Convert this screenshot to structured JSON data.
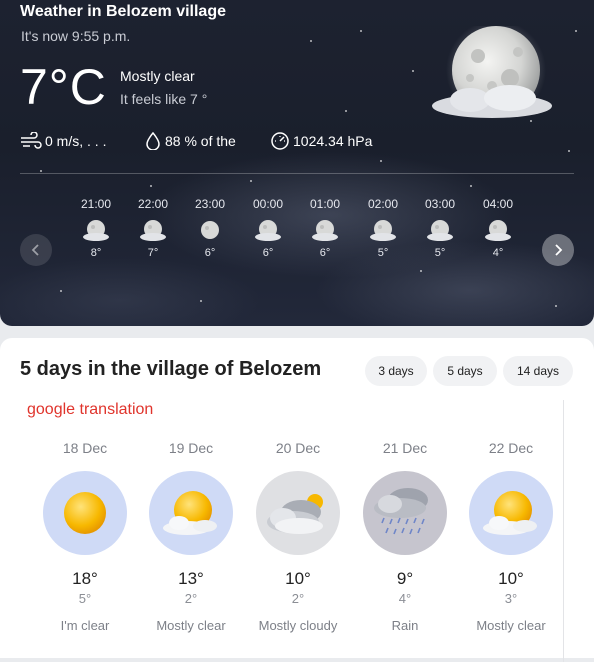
{
  "now": {
    "title": "Weather in Belozem village",
    "subtitle": "It's now 9:55 p.m.",
    "temperature": "7°C",
    "condition": "Mostly clear",
    "feels_like": "It feels like 7 °",
    "icon": "moon-cloud-icon",
    "stats": {
      "wind": "0 m/s,  . . .",
      "humidity": "88 % of the",
      "pressure": "1024.34 hPa"
    }
  },
  "hourly": [
    {
      "time": "21:00",
      "temp": "8°",
      "icon": "moon-icon"
    },
    {
      "time": "22:00",
      "temp": "7°",
      "icon": "moon-icon"
    },
    {
      "time": "23:00",
      "temp": "6°",
      "icon": "moon-icon"
    },
    {
      "time": "00:00",
      "temp": "6°",
      "icon": "moon-icon"
    },
    {
      "time": "01:00",
      "temp": "6°",
      "icon": "moon-icon"
    },
    {
      "time": "02:00",
      "temp": "5°",
      "icon": "moon-icon"
    },
    {
      "time": "03:00",
      "temp": "5°",
      "icon": "moon-icon"
    },
    {
      "time": "04:00",
      "temp": "4°",
      "icon": "moon-icon"
    }
  ],
  "forecast": {
    "title": "5 days in the village of Belozem",
    "ranges": [
      "3 days",
      "5 days",
      "14 days"
    ],
    "translation_note": "google translation",
    "days": [
      {
        "date": "18 Dec",
        "high": "18°",
        "low": "5°",
        "condition": "I'm clear",
        "icon": "sun-icon",
        "bg": "#cfdaf6"
      },
      {
        "date": "19 Dec",
        "high": "13°",
        "low": "2°",
        "condition": "Mostly clear",
        "icon": "sun-cloud-icon",
        "bg": "#cfdaf6"
      },
      {
        "date": "20 Dec",
        "high": "10°",
        "low": "2°",
        "condition": "Mostly cloudy",
        "icon": "cloudy-icon",
        "bg": "#dfe0e3"
      },
      {
        "date": "21 Dec",
        "high": "9°",
        "low": "4°",
        "condition": "Rain",
        "icon": "rain-icon",
        "bg": "#c6c5ce"
      },
      {
        "date": "22 Dec",
        "high": "10°",
        "low": "3°",
        "condition": "Mostly clear",
        "icon": "sun-cloud-icon",
        "bg": "#cfdaf6"
      }
    ]
  }
}
